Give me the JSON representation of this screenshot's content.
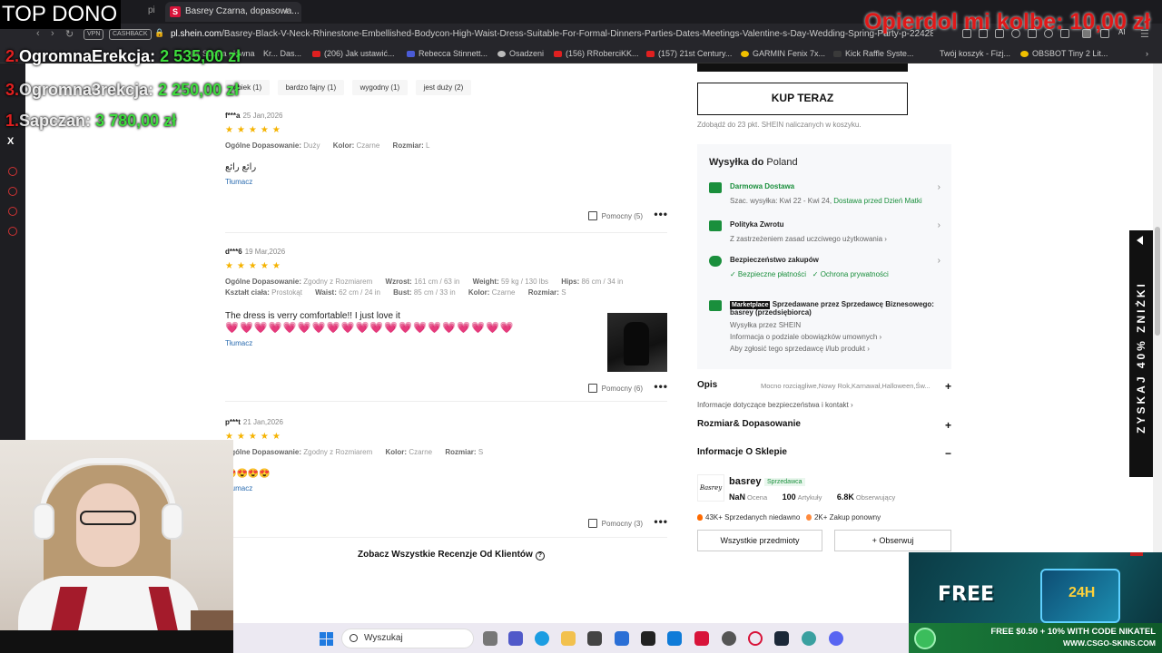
{
  "browser": {
    "tab_title": "Basrey Czarna, dopasowa...",
    "tab_left_fragment": "pi",
    "url_domain": "pl.shein.com",
    "url_path": "/Basrey-Black-V-Neck-Rhinestone-Embellished-Bodycon-High-Waist-Dress-Suitable-For-Formal-Dinners-Parties-Dates-Meetings-Valentine-s-Day-Wedding-Spring-Party-p-22428646.html",
    "vpn_label": "VPN",
    "cashback_label": "CASHBACK",
    "ai_label": "AI",
    "bookmarks": [
      "Strona główna",
      "Kr... Das...",
      "(206) Jak ustawić...",
      "Rebecca Stinnett...",
      "Osadzeni",
      "(156) RRoberciKK...",
      "(157) 21st Century...",
      "GARMIN Fenix 7x...",
      "Kick Raffle Syste...",
      "Twój koszyk - Fizj...",
      "OBSBOT Tiny 2 Lit..."
    ]
  },
  "reviews": {
    "filter_chips": [
      "obiek (1)",
      "bardzo fajny (1)",
      "wygodny (1)",
      "jest duży (2)"
    ],
    "items": [
      {
        "user": "f***a",
        "date": "25 Jan,2026",
        "stars": "★★★★★",
        "fit_label": "Ogólne Dopasowanie:",
        "fit_value": "Duży",
        "color_label": "Kolor:",
        "color_value": "Czarne",
        "size_label": "Rozmiar:",
        "size_value": "L",
        "text": "رائع رائع",
        "translate": "Tłumacz",
        "helpful": "Pomocny (5)"
      },
      {
        "user": "d***6",
        "date": "19 Mar,2026",
        "stars": "★★★★★",
        "fit_label": "Ogólne Dopasowanie:",
        "fit_value": "Zgodny z Rozmiarem",
        "height_label": "Wzrost:",
        "height_value": "161 cm / 63 in",
        "weight_label": "Weight:",
        "weight_value": "59 kg / 130 lbs",
        "hips_label": "Hips:",
        "hips_value": "86 cm / 34 in",
        "body_label": "Kształt ciała:",
        "body_value": "Prostokąt",
        "waist_label": "Waist:",
        "waist_value": "62 cm / 24 in",
        "bust_label": "Bust:",
        "bust_value": "85 cm / 33 in",
        "color_label": "Kolor:",
        "color_value": "Czarne",
        "size_label": "Rozmiar:",
        "size_value": "S",
        "text": "The dress is verry comfortable!! I just love it",
        "hearts": "💗💗💗💗💗💗💗💗💗💗💗💗💗💗💗💗💗💗💗💗",
        "translate": "Tłumacz",
        "helpful": "Pomocny (6)"
      },
      {
        "user": "p***t",
        "date": "21 Jan,2026",
        "stars": "★★★★★",
        "fit_label": "Ogólne Dopasowanie:",
        "fit_value": "Zgodny z Rozmiarem",
        "color_label": "Kolor:",
        "color_value": "Czarne",
        "size_label": "Rozmiar:",
        "size_value": "S",
        "text": "😍😍😍😍",
        "translate": "Tłumacz",
        "helpful": "Pomocny (3)"
      }
    ],
    "see_all": "Zobacz Wszystkie Recenzje Od Klientów"
  },
  "purchase": {
    "buy_now": "KUP TERAZ",
    "points": "Zdobądź do 23 pkt. SHEIN naliczanych w koszyku."
  },
  "shipping": {
    "title_prefix": "Wysyłka do",
    "country": "Poland",
    "free_delivery": "Darmowa Dostawa",
    "est_prefix": "Szac. wysyłka: Kwi 22 - Kwi 24,",
    "est_suffix": "Dostawa przed Dzień Matki",
    "return_title": "Polityka Zwrotu",
    "return_sub": "Z zastrzeżeniem zasad uczciwego użytkowania ›",
    "security_title": "Bezpieczeństwo zakupów",
    "security_a": "✓ Bezpieczne płatności",
    "security_b": "✓ Ochrona prywatności",
    "marketplace_tag": "Marketplace",
    "marketplace_text": "Sprzedawane przez Sprzedawcę Biznesowego: basrey (przedsiębiorca)",
    "ships_by": "Wysyłka przez SHEIN",
    "obligations": "Informacja o podziale obowiązków umownych ›",
    "report": "Aby zgłosić tego sprzedawcę i/lub produkt ›"
  },
  "accordions": {
    "description_label": "Opis",
    "description_preview": "Mocno rozciągliwe,Nowy Rok,Karnawał,Halloween,Św...",
    "safety_info": "Informacje dotyczące bezpieczeństwa i kontakt ›",
    "size_fit": "Rozmiar& Dopasowanie",
    "store_info": "Informacje O Sklepie"
  },
  "store": {
    "logo": "Basrey",
    "name": "basrey",
    "badge": "Sprzedawca",
    "rating_value": "NaN",
    "rating_label": "Ocena",
    "items_value": "100",
    "items_label": "Artykuły",
    "followers_value": "6.8K",
    "followers_label": "Obserwujący",
    "sold_recently": "43K+ Sprzedanych niedawno",
    "repeat": "2K+ Zakup ponowny",
    "all_items": "Wszystkie przedmioty",
    "follow": "+ Obserwuj"
  },
  "promo_tab": "ZYSKAJ 40% ZNIŻKI",
  "stream_overlay": {
    "title": "TOP DONO",
    "ranks": [
      {
        "num": "2.",
        "name": "OgromnaErekcja:",
        "amount": "2 535,00 zł"
      },
      {
        "num": "3.",
        "name": "Ogromna3rekcja:",
        "amount": "2 250,00 zł"
      },
      {
        "num": "1.",
        "name": "Sapczan:",
        "amount": "3 780,00 zł"
      }
    ],
    "x_label": "X",
    "goal": "Opierdol mi kolbe: 10,00 zł"
  },
  "ad": {
    "free": "FREE",
    "label_24": "24H",
    "line1": "FREE $0.50 + 10% WITH CODE NIKATEL",
    "line2": "WWW.CSGO-SKINS.COM"
  },
  "taskbar": {
    "search": "Wyszukaj"
  }
}
